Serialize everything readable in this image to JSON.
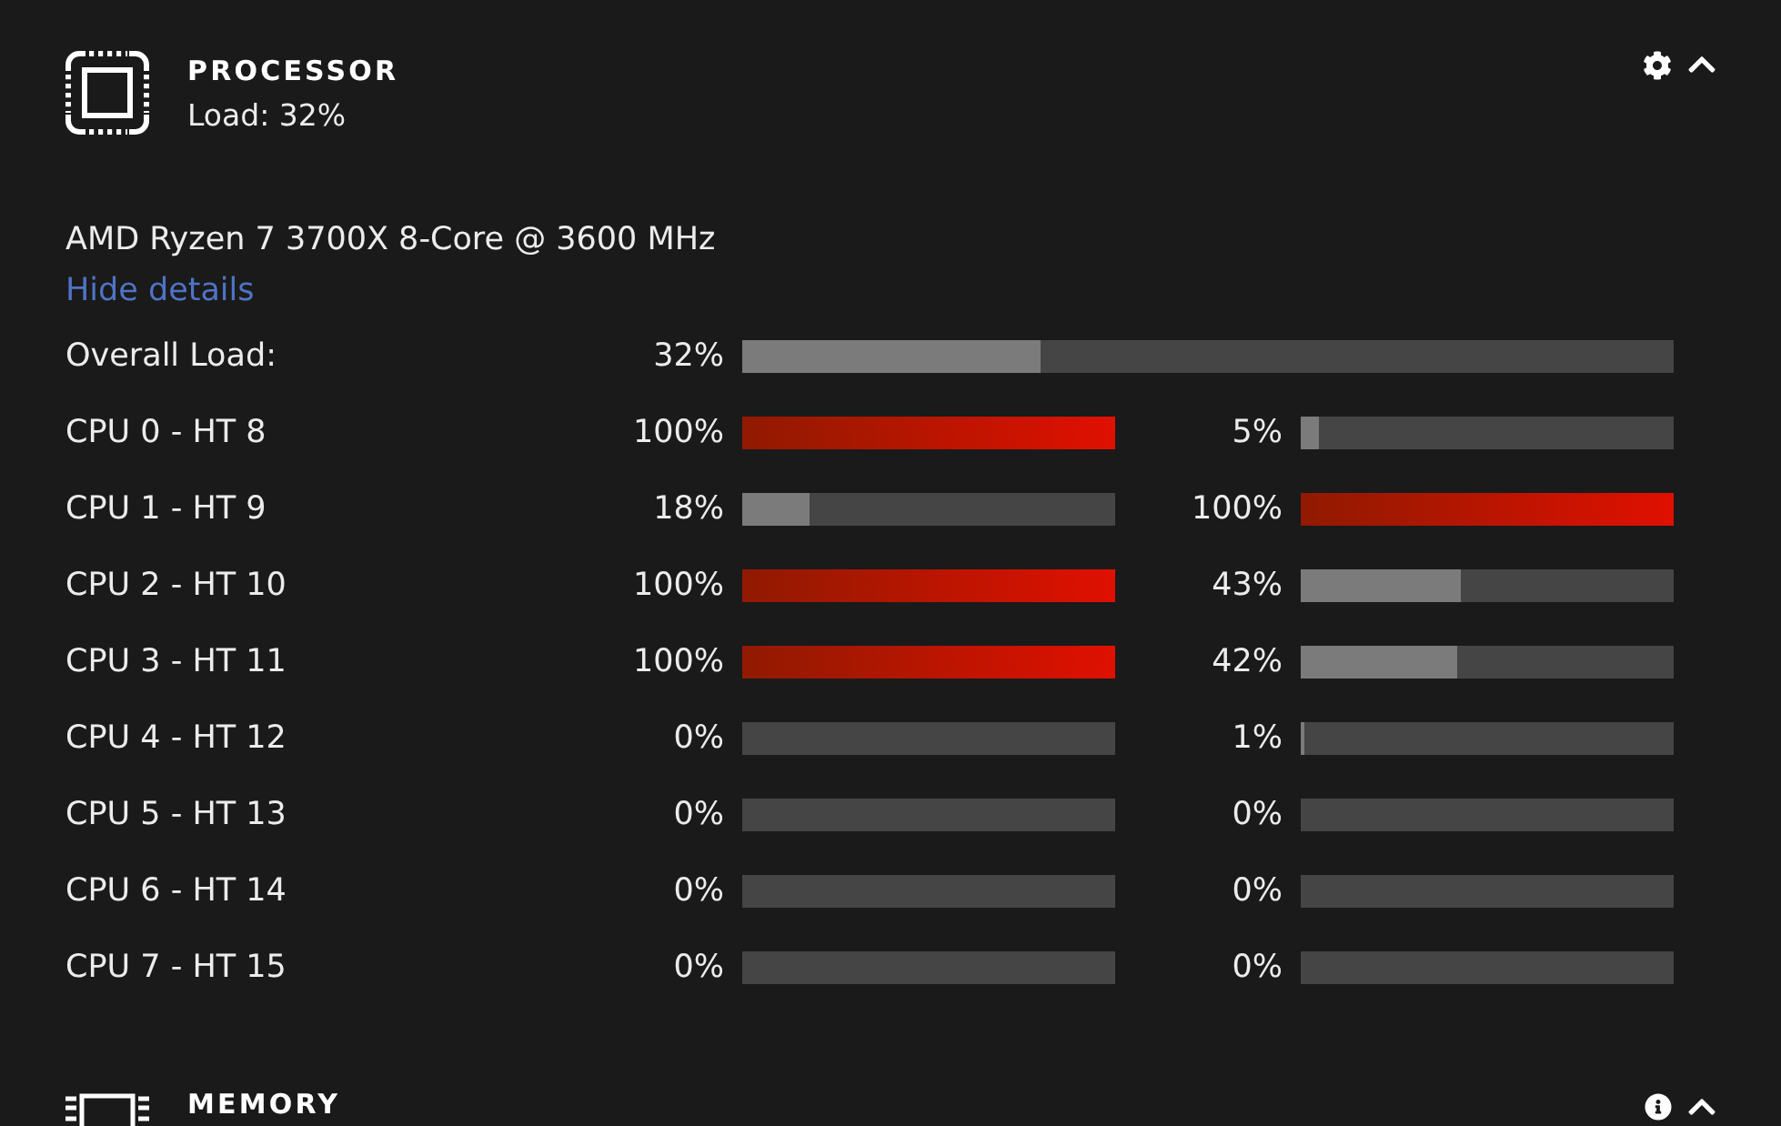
{
  "processor": {
    "title": "PROCESSOR",
    "load": "Load: 32%",
    "expanded": true,
    "model": "AMD Ryzen 7 3700X 8-Core @ 3600 MHz",
    "details_link": "Hide details",
    "overall": {
      "label": "Overall Load:",
      "reading": "32%",
      "level": 0.32
    },
    "cores": [
      {
        "label": "CPU 0 - HT 8",
        "threads": [
          {
            "reading": "100%",
            "level": 1
          },
          {
            "reading": "5%",
            "level": 0.05
          }
        ]
      },
      {
        "label": "CPU 1 - HT 9",
        "threads": [
          {
            "reading": "18%",
            "level": 0.18
          },
          {
            "reading": "100%",
            "level": 1
          }
        ]
      },
      {
        "label": "CPU 2 - HT 10",
        "threads": [
          {
            "reading": "100%",
            "level": 1
          },
          {
            "reading": "43%",
            "level": 0.43
          }
        ]
      },
      {
        "label": "CPU 3 - HT 11",
        "threads": [
          {
            "reading": "100%",
            "level": 1
          },
          {
            "reading": "42%",
            "level": 0.42
          }
        ]
      },
      {
        "label": "CPU 4 - HT 12",
        "threads": [
          {
            "reading": "0%",
            "level": 0
          },
          {
            "reading": "1%",
            "level": 0.01
          }
        ]
      },
      {
        "label": "CPU 5 - HT 13",
        "threads": [
          {
            "reading": "0%",
            "level": 0
          },
          {
            "reading": "0%",
            "level": 0
          }
        ]
      },
      {
        "label": "CPU 6 - HT 14",
        "threads": [
          {
            "reading": "0%",
            "level": 0
          },
          {
            "reading": "0%",
            "level": 0
          }
        ]
      },
      {
        "label": "CPU 7 - HT 15",
        "threads": [
          {
            "reading": "0%",
            "level": 0
          },
          {
            "reading": "0%",
            "level": 0
          }
        ]
      }
    ]
  },
  "memory": {
    "title": "MEMORY",
    "expanded": true
  }
}
